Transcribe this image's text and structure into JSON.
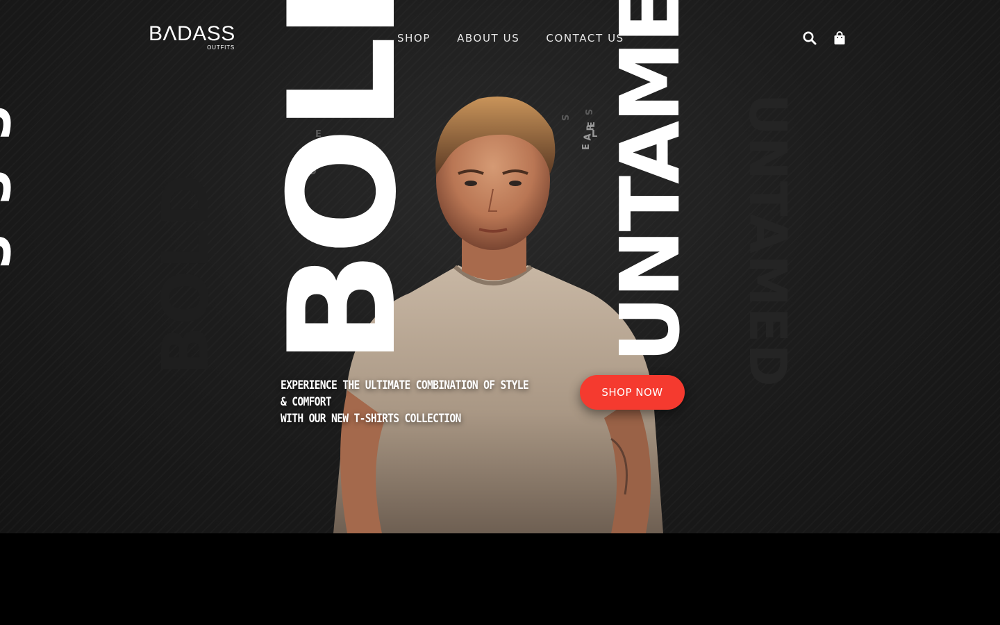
{
  "brand": {
    "logo_main": "BΛDASS",
    "logo_sub": "OUTFITS"
  },
  "nav": {
    "items": [
      "SHOP",
      "ABOUT US",
      "CONTACT US"
    ]
  },
  "header_icons": {
    "search": "search-icon",
    "cart": "shopping-bag-icon"
  },
  "hero": {
    "word_left": "BOLD",
    "word_right": "UNTAMED",
    "ghost_left": "BOLD",
    "ghost_right": "UNTAMED",
    "edge_text": "SSS",
    "scatter": [
      "E",
      "A",
      "R",
      "L",
      "E",
      "S",
      "S",
      "D",
      "N",
      "E"
    ],
    "tagline_line1": "EXPERIENCE THE ULTIMATE COMBINATION OF STYLE & COMFORT",
    "tagline_line2": "WITH OUR NEW T-SHIRTS COLLECTION",
    "cta_label": "SHOP NOW"
  },
  "colors": {
    "accent": "#f53a2f",
    "background": "#1d1d1d",
    "text": "#ffffff"
  }
}
